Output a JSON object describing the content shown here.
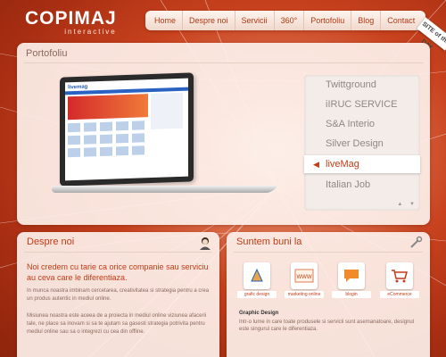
{
  "brand": {
    "name": "COPIMAJ",
    "tagline": "interactive"
  },
  "nav": {
    "items": [
      "Home",
      "Despre noi",
      "Servicii",
      "360°",
      "Portofoliu",
      "Blog",
      "Contact"
    ]
  },
  "badge": {
    "text": "SITE of the DAY"
  },
  "portfolio": {
    "title": "Portofoliu",
    "items": [
      "Twittground",
      "iIRUC SERVICE",
      "S&A Interio",
      "Silver Design",
      "liveMag",
      "Italian Job"
    ],
    "active_index": 4,
    "preview_logo": "livemag"
  },
  "despre": {
    "title": "Despre noi",
    "lead": "Noi credem cu tarie ca orice companie sau serviciu au ceva care le diferentiaza.",
    "p1": "In munca noastra imbinam cercetarea, creativitatea si strategia pentru a crea un produs autentic in mediul online.",
    "p2": "Misiunea noastra este aceea de a proiecta in mediul online viziunea afacerii tale, ne place sa inovam si sa te ajutam sa gasesti strategia potrivita pentru mediul online sau sa o integrezi cu cea din offline."
  },
  "suntem": {
    "title": "Suntem buni la",
    "services": [
      {
        "label": "grafic design",
        "icon": "pen-tool-icon"
      },
      {
        "label": "marketing online",
        "icon": "www-icon"
      },
      {
        "label": "blogin",
        "icon": "speech-bubble-icon"
      },
      {
        "label": "eCommerce",
        "icon": "shopping-cart-icon"
      }
    ],
    "detail_title": "Graphic Design",
    "detail_text": "Intr-o lume in care toate produsele si servicii sunt asemanatoare, designul este singurul care le diferentiaza."
  },
  "colors": {
    "accent": "#c23c16",
    "background": "#c8421e",
    "panel": "#fdf1ec"
  }
}
